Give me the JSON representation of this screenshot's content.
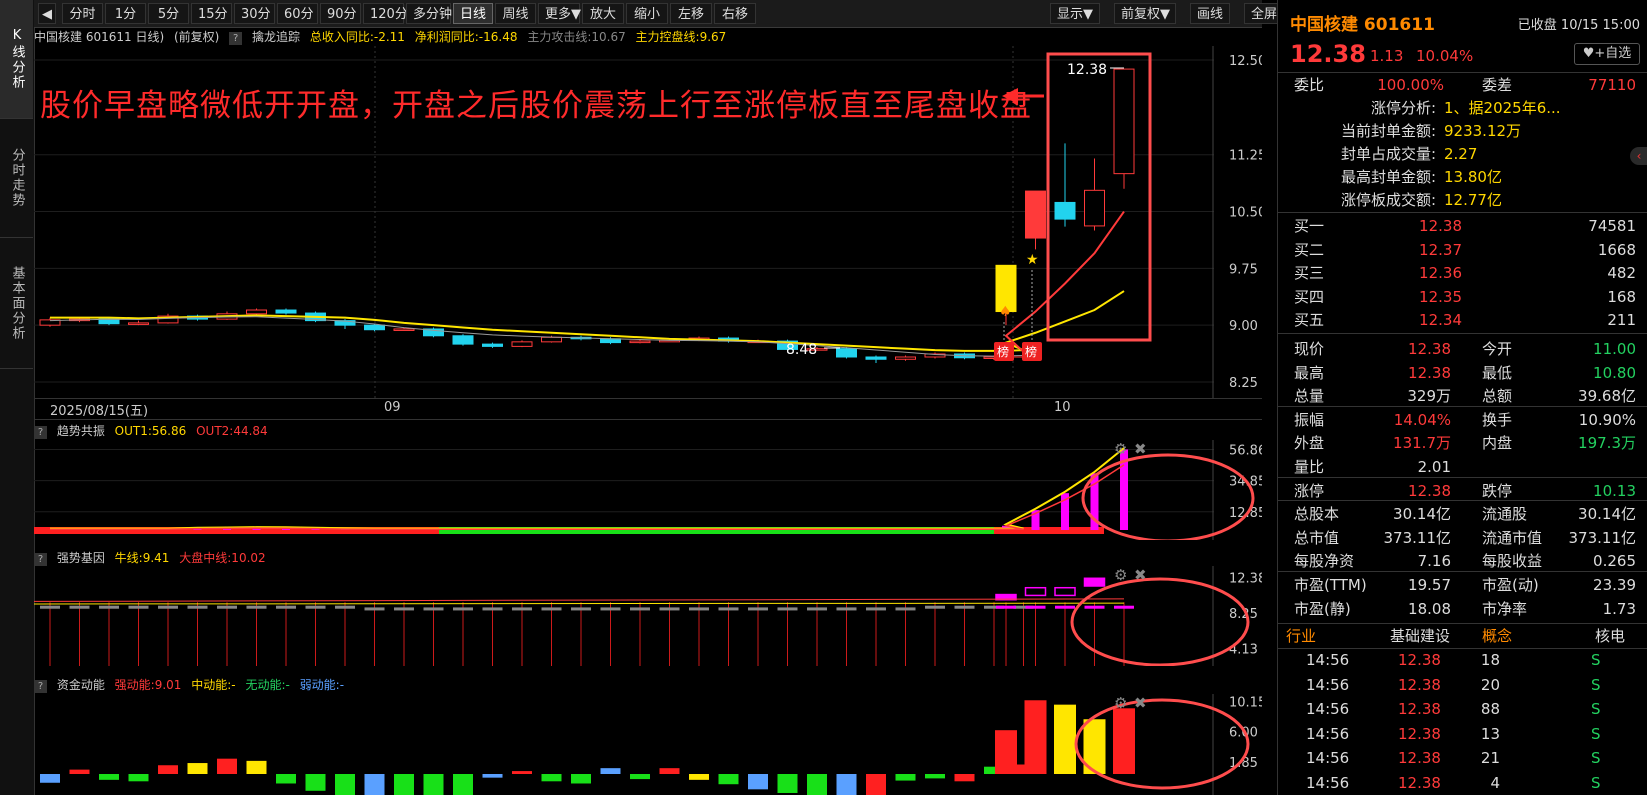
{
  "toolbar": {
    "buttons": [
      "分时",
      "1分",
      "5分",
      "15分",
      "30分",
      "60分",
      "90分",
      "120分",
      "多分钟",
      "日线",
      "周线",
      "更多▼",
      "放大",
      "缩小",
      "左移",
      "右移"
    ],
    "right_buttons": [
      "显示▼",
      "前复权▼",
      "画线",
      "全屏"
    ],
    "active": "日线"
  },
  "left_tabs": [
    "K线分析",
    "分时走势",
    "基本面分析"
  ],
  "main": {
    "header_items": [
      "中国核建 601611 日线)",
      "(前复权)"
    ],
    "indicator_name": "擒龙追踪",
    "revenue": "总收入同比:-2.11",
    "profit": "净利润同比:-16.48",
    "attack_line": "主力攻击线:10.67",
    "control_line": "主力控盘线:9.67",
    "annotation": "股价早盘略微低开开盘，开盘之后股价震荡上行至涨停板直至尾盘收盘",
    "high_label": "12.38",
    "low_label": "8.48",
    "bang_label": "榜",
    "price_ticks": [
      "12.50",
      "11.25",
      "10.50",
      "9.75",
      "9.00",
      "8.25"
    ],
    "date_start": "2025/08/15(五)",
    "month_labels": [
      "09",
      "10"
    ]
  },
  "sub1": {
    "name": "趋势共振",
    "out1": "OUT1:56.86",
    "out2": "OUT2:44.84",
    "ticks": [
      "56.86",
      "34.85",
      "12.85"
    ]
  },
  "sub2": {
    "name": "强势基因",
    "bull": "牛线:9.41",
    "market": "大盘中线:10.02",
    "ticks": [
      "12.38",
      "8.25",
      "4.13"
    ]
  },
  "sub3": {
    "name": "资金动能",
    "strong": "强动能:9.01",
    "mid": "中动能:-",
    "none": "无动能:-",
    "weak": "弱动能:-",
    "ticks": [
      "10.15",
      "6.00",
      "1.85"
    ]
  },
  "quote": {
    "name": "中国核建",
    "code": "601611",
    "status": "已收盘 10/15 15:00",
    "price": "12.38",
    "change": "1.13",
    "pct": "10.04%",
    "add_btn": "+自选",
    "weibi_label": "委比",
    "weibi": "100.00%",
    "weicha_label": "委差",
    "weicha": "77110",
    "limit_info": [
      {
        "k": "涨停分析:",
        "v": "1、据2025年6..."
      },
      {
        "k": "当前封单金额:",
        "v": "9233.12万"
      },
      {
        "k": "封单占成交量:",
        "v": "2.27"
      },
      {
        "k": "最高封单金额:",
        "v": "13.80亿"
      },
      {
        "k": "涨停板成交额:",
        "v": "12.77亿"
      }
    ],
    "bids": [
      {
        "label": "买一",
        "price": "12.38",
        "vol": "74581"
      },
      {
        "label": "买二",
        "price": "12.37",
        "vol": "1668"
      },
      {
        "label": "买三",
        "price": "12.36",
        "vol": "482"
      },
      {
        "label": "买四",
        "price": "12.35",
        "vol": "168"
      },
      {
        "label": "买五",
        "price": "12.34",
        "vol": "211"
      }
    ],
    "stats": [
      {
        "l1": "现价",
        "v1": "12.38",
        "c1": "red",
        "l2": "今开",
        "v2": "11.00",
        "c2": "green"
      },
      {
        "l1": "最高",
        "v1": "12.38",
        "c1": "red",
        "l2": "最低",
        "v2": "10.80",
        "c2": "green"
      },
      {
        "l1": "总量",
        "v1": "329万",
        "c1": "white",
        "l2": "总额",
        "v2": "39.68亿",
        "c2": "white"
      },
      {
        "l1": "振幅",
        "v1": "14.04%",
        "c1": "red",
        "l2": "换手",
        "v2": "10.90%",
        "c2": "white"
      },
      {
        "l1": "外盘",
        "v1": "131.7万",
        "c1": "red",
        "l2": "内盘",
        "v2": "197.3万",
        "c2": "green"
      },
      {
        "l1": "量比",
        "v1": "2.01",
        "c1": "white",
        "l2": "",
        "v2": "",
        "c2": "white"
      },
      {
        "l1": "涨停",
        "v1": "12.38",
        "c1": "red",
        "l2": "跌停",
        "v2": "10.13",
        "c2": "green"
      },
      {
        "l1": "总股本",
        "v1": "30.14亿",
        "c1": "white",
        "l2": "流通股",
        "v2": "30.14亿",
        "c2": "white"
      },
      {
        "l1": "总市值",
        "v1": "373.11亿",
        "c1": "white",
        "l2": "流通市值",
        "v2": "373.11亿",
        "c2": "white"
      },
      {
        "l1": "每股净资",
        "v1": "7.16",
        "c1": "white",
        "l2": "每股收益",
        "v2": "0.265",
        "c2": "white"
      },
      {
        "l1": "市盈(TTM)",
        "v1": "19.57",
        "c1": "white",
        "l2": "市盈(动)",
        "v2": "23.39",
        "c2": "white"
      },
      {
        "l1": "市盈(静)",
        "v1": "18.08",
        "c1": "white",
        "l2": "市净率",
        "v2": "1.73",
        "c2": "white"
      }
    ],
    "industry_label": "行业",
    "industry": "基础建设",
    "concept_label": "概念",
    "concept": "核电",
    "ticks": [
      {
        "time": "14:56",
        "price": "12.38",
        "vol": "18",
        "side": "S"
      },
      {
        "time": "14:56",
        "price": "12.38",
        "vol": "20",
        "side": "S"
      },
      {
        "time": "14:56",
        "price": "12.38",
        "vol": "88",
        "side": "S"
      },
      {
        "time": "14:56",
        "price": "12.38",
        "vol": "13",
        "side": "S"
      },
      {
        "time": "14:56",
        "price": "12.38",
        "vol": "21",
        "side": "S"
      },
      {
        "time": "14:56",
        "price": "12.38",
        "vol": "4",
        "side": "S"
      }
    ]
  },
  "chart_data": {
    "type": "candlestick",
    "ylim": [
      8.25,
      12.5
    ],
    "candles": [
      [
        9.0,
        9.07,
        9.1,
        8.98
      ],
      [
        9.07,
        9.08,
        9.1,
        9.04
      ],
      [
        9.08,
        9.02,
        9.1,
        9.0
      ],
      [
        9.02,
        9.03,
        9.06,
        9.0
      ],
      [
        9.03,
        9.12,
        9.15,
        9.02
      ],
      [
        9.12,
        9.08,
        9.14,
        9.06
      ],
      [
        9.08,
        9.15,
        9.18,
        9.07
      ],
      [
        9.15,
        9.2,
        9.22,
        9.13
      ],
      [
        9.2,
        9.16,
        9.22,
        9.14
      ],
      [
        9.16,
        9.06,
        9.18,
        9.04
      ],
      [
        9.06,
        9.0,
        9.08,
        8.95
      ],
      [
        9.0,
        8.94,
        9.02,
        8.92
      ],
      [
        8.94,
        8.95,
        8.97,
        8.93
      ],
      [
        8.95,
        8.86,
        8.97,
        8.84
      ],
      [
        8.86,
        8.75,
        8.88,
        8.73
      ],
      [
        8.75,
        8.72,
        8.77,
        8.7
      ],
      [
        8.72,
        8.78,
        8.8,
        8.71
      ],
      [
        8.78,
        8.84,
        8.86,
        8.77
      ],
      [
        8.84,
        8.82,
        8.86,
        8.8
      ],
      [
        8.82,
        8.77,
        8.84,
        8.75
      ],
      [
        8.77,
        8.79,
        8.81,
        8.76
      ],
      [
        8.79,
        8.8,
        8.82,
        8.78
      ],
      [
        8.8,
        8.83,
        8.85,
        8.79
      ],
      [
        8.83,
        8.79,
        8.85,
        8.77
      ],
      [
        8.79,
        8.79,
        8.81,
        8.77
      ],
      [
        8.79,
        8.68,
        8.81,
        8.66
      ],
      [
        8.68,
        8.69,
        8.71,
        8.67
      ],
      [
        8.69,
        8.58,
        8.71,
        8.56
      ],
      [
        8.58,
        8.55,
        8.6,
        8.5
      ],
      [
        8.55,
        8.58,
        8.6,
        8.53
      ],
      [
        8.58,
        8.62,
        8.64,
        8.56
      ],
      [
        8.62,
        8.57,
        8.64,
        8.55
      ],
      [
        8.57,
        8.58,
        8.6,
        8.54
      ],
      [
        8.58,
        8.67,
        8.7,
        8.56
      ],
      [
        9.18,
        9.79,
        9.79,
        9.0
      ],
      [
        10.15,
        10.77,
        10.77,
        10.0
      ],
      [
        10.62,
        10.4,
        11.4,
        10.3
      ],
      [
        10.31,
        10.78,
        11.2,
        10.25
      ],
      [
        11.0,
        12.38,
        12.38,
        10.8
      ]
    ],
    "ma_yellow": [
      9.1,
      9.1,
      9.1,
      9.09,
      9.1,
      9.11,
      9.12,
      9.13,
      9.12,
      9.11,
      9.1,
      9.07,
      9.03,
      9.0,
      8.97,
      8.94,
      8.92,
      8.9,
      8.88,
      8.86,
      8.84,
      8.82,
      8.81,
      8.8,
      8.79,
      8.77,
      8.75,
      8.73,
      8.71,
      8.69,
      8.67,
      8.66,
      8.66,
      8.67,
      8.77,
      8.9,
      9.05,
      9.2,
      9.45
    ],
    "ma_red": [
      null,
      null,
      null,
      null,
      null,
      null,
      null,
      null,
      null,
      null,
      null,
      null,
      null,
      null,
      null,
      null,
      null,
      null,
      null,
      null,
      null,
      null,
      null,
      null,
      null,
      null,
      null,
      null,
      null,
      null,
      null,
      null,
      null,
      8.65,
      8.86,
      9.18,
      9.55,
      9.95,
      10.5
    ],
    "sub1_values": [
      0,
      0,
      0,
      0,
      0,
      0.6,
      0.8,
      1,
      0.9,
      0.6,
      0.2,
      0,
      0,
      0,
      0,
      0,
      0,
      0,
      0,
      0,
      0,
      0,
      0,
      0,
      0,
      0,
      0,
      0,
      0,
      0,
      0,
      0,
      0,
      0,
      3,
      14,
      26,
      40,
      56.86
    ],
    "sub3_values": [
      -1.2,
      0.6,
      -0.8,
      -1,
      1.2,
      1.5,
      2.1,
      1.8,
      -1.3,
      -2.3,
      -3.2,
      -3.5,
      -3.8,
      -3.9,
      -3.5,
      -0.5,
      0.4,
      -1,
      -1.3,
      0.8,
      -0.7,
      0.8,
      -0.8,
      -1.4,
      -2.1,
      -2.6,
      -3,
      -3.3,
      -2.9,
      -0.9,
      -0.6,
      -1,
      1,
      1.3,
      6,
      10.1,
      9.5,
      7.5,
      9.0
    ]
  }
}
